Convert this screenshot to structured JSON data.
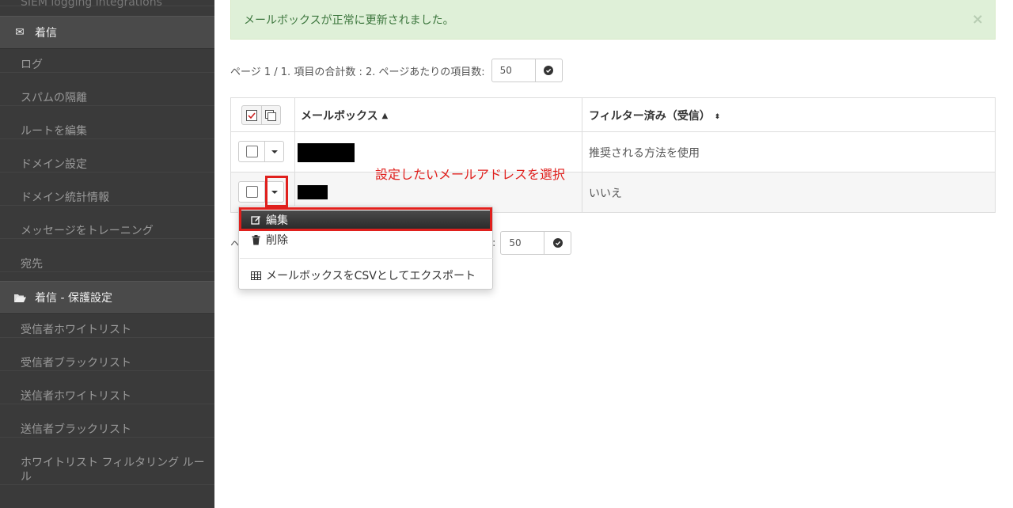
{
  "sidebar": {
    "top_cut_item": "SIEM logging integrations",
    "section_incoming": {
      "icon": "envelope-icon",
      "label": "着信"
    },
    "incoming_items": [
      "ログ",
      "スパムの隔離",
      "ルートを編集",
      "ドメイン設定",
      "ドメイン統計情報",
      "メッセージをトレーニング",
      "宛先"
    ],
    "section_protection": {
      "icon": "folder-open-icon",
      "label": "着信 - 保護設定"
    },
    "protection_items": [
      "受信者ホワイトリスト",
      "受信者ブラックリスト",
      "送信者ホワイトリスト",
      "送信者ブラックリスト",
      "ホワイトリスト フィルタリング ルール"
    ]
  },
  "alert": {
    "message": "メールボックスが正常に更新されました。",
    "close": "×"
  },
  "pager": {
    "text": "ページ 1 / 1. 項目の合計数 : 2. ページあたりの項目数:",
    "per_page": "50",
    "bottom_text_fragment_left": "ヘ",
    "bottom_text_fragment_right": ":",
    "bottom_per_page": "50"
  },
  "table": {
    "columns": [
      "メールボックス",
      "フィルター済み（受信）"
    ],
    "rows": [
      {
        "mailbox": "",
        "filtered": "推奨される方法を使用"
      },
      {
        "mailbox": "",
        "filtered": "いいえ"
      }
    ]
  },
  "menu": {
    "items": [
      {
        "icon": "edit-icon",
        "label": "編集"
      },
      {
        "icon": "trash-icon",
        "label": "削除"
      },
      {
        "icon": "table-icon",
        "label": "メールボックスをCSVとしてエクスポート"
      }
    ]
  },
  "annotation": {
    "text": "設定したいメールアドレスを選択",
    "color": "#e0201d"
  }
}
